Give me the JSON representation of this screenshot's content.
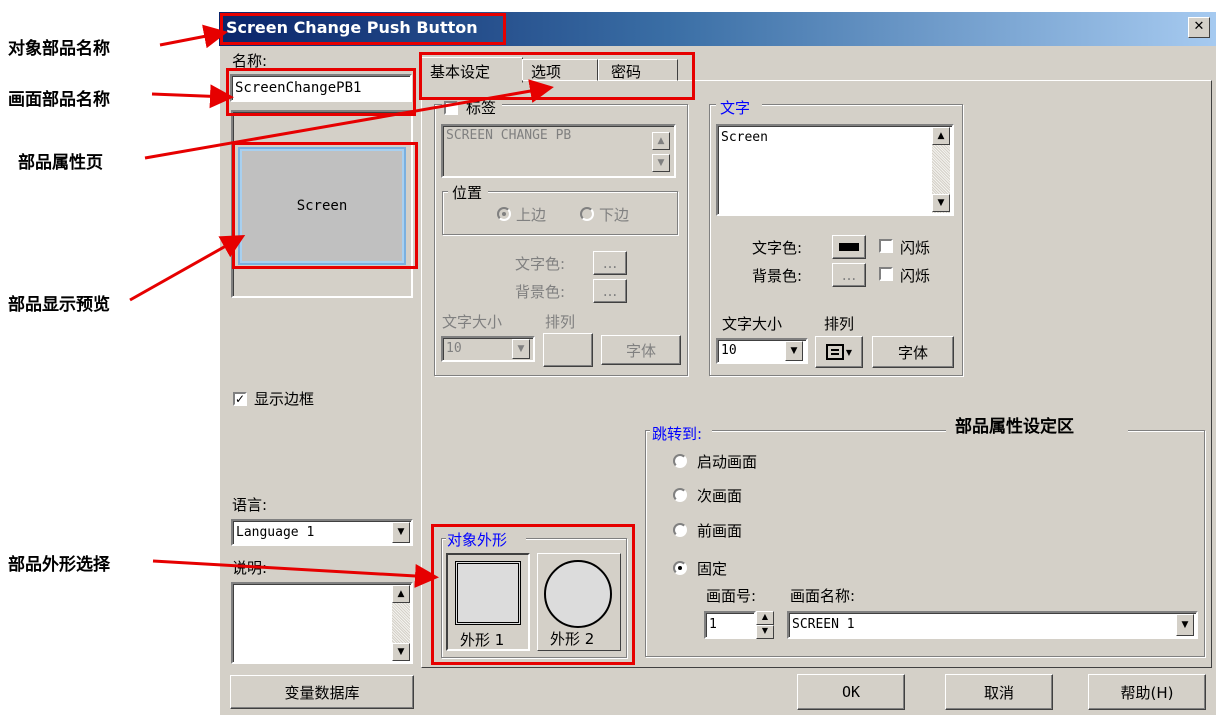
{
  "window": {
    "title": "Screen Change Push Button",
    "close_glyph": "✕"
  },
  "left": {
    "name_label": "名称:",
    "name_value": "ScreenChangePB1",
    "preview_text": "Screen",
    "show_border_label": "显示边框",
    "show_border_checked": true,
    "language_label": "语言:",
    "language_value": "Language 1",
    "description_label": "说明:",
    "tag_db_button": "变量数据库"
  },
  "tabs": [
    {
      "label": "基本设定",
      "active": true
    },
    {
      "label": "选项",
      "active": false
    },
    {
      "label": "密码",
      "active": false
    }
  ],
  "label_group": {
    "title": "标签",
    "checked": false,
    "text": "SCREEN CHANGE PB",
    "position_title": "位置",
    "position_top": "上边",
    "position_bottom": "下边",
    "text_color_label": "文字色:",
    "bg_color_label": "背景色:",
    "color_btn": "...",
    "font_size_label": "文字大小",
    "align_label": "排列",
    "font_size_value": "10",
    "font_button": "字体"
  },
  "text_group": {
    "title": "文字",
    "text": "Screen",
    "text_color_label": "文字色:",
    "bg_color_label": "背景色:",
    "blink_label": "闪烁",
    "color_btn": "...",
    "font_size_label": "文字大小",
    "align_label": "排列",
    "font_size_value": "10",
    "font_button": "字体",
    "text_color": "#000000"
  },
  "shape_group": {
    "title": "对象外形",
    "shape1_label": "外形 1",
    "shape2_label": "外形 2"
  },
  "jump_group": {
    "title": "跳转到:",
    "options": [
      {
        "label": "启动画面",
        "selected": false
      },
      {
        "label": "次画面",
        "selected": false
      },
      {
        "label": "前画面",
        "selected": false
      },
      {
        "label": "固定",
        "selected": true
      }
    ],
    "screen_no_label": "画面号:",
    "screen_name_label": "画面名称:",
    "screen_no_value": "1",
    "screen_name_value": "SCREEN 1"
  },
  "buttons": {
    "ok": "OK",
    "cancel": "取消",
    "help": "帮助(H)"
  },
  "annotations": {
    "object_name": "对象部品名称",
    "screen_part_name": "画面部品名称",
    "property_page": "部品属性页",
    "preview": "部品显示预览",
    "shape_select": "部品外形选择",
    "setting_area": "部品属性设定区"
  },
  "colors": {
    "accent_red": "#e60000",
    "title_bar": "#0a246a",
    "dialog_bg": "#d4d0c8"
  }
}
